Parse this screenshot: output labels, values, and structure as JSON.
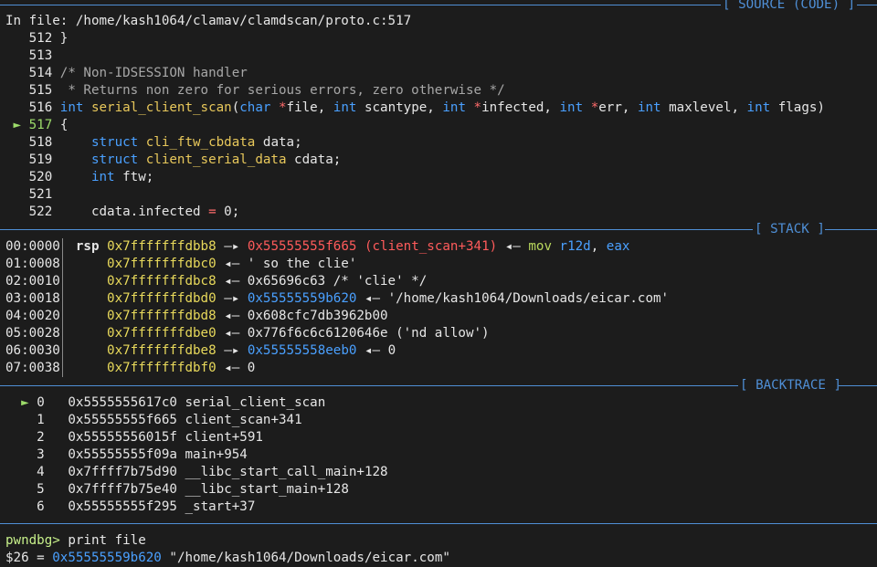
{
  "source": {
    "header_label": "[ SOURCE (CODE) ]",
    "file_line": "In file: /home/kash1064/clamav/clamdscan/proto.c:517",
    "lines": [
      {
        "num": "512",
        "text": "}"
      },
      {
        "num": "513",
        "text": ""
      },
      {
        "num": "514",
        "text": "/* Non-IDSESSION handler"
      },
      {
        "num": "515",
        "text": " * Returns non zero for serious errors, zero otherwise */"
      },
      {
        "num": "516",
        "text": "int serial_client_scan(char *file, int scantype, int *infected, int *err, int maxlevel, int flags)"
      },
      {
        "num": "517",
        "text": "{"
      },
      {
        "num": "518",
        "text": "    struct cli_ftw_cbdata data;"
      },
      {
        "num": "519",
        "text": "    struct client_serial_data cdata;"
      },
      {
        "num": "520",
        "text": "    int ftw;"
      },
      {
        "num": "521",
        "text": ""
      },
      {
        "num": "522",
        "text": "    cdata.infected = 0;"
      }
    ],
    "current_marker": "►"
  },
  "stack": {
    "header_label": "[ STACK ]",
    "rows": [
      {
        "offset": "00:0000",
        "reg": "rsp",
        "addr": "0x7fffffffdbb8",
        "arrow": "—▸",
        "target": "0x55555555f665 (client_scan+341)",
        "tail": "◂— mov r12d, eax"
      },
      {
        "offset": "01:0008",
        "addr": "0x7fffffffdbc0",
        "tail": "◂— ' so the clie'"
      },
      {
        "offset": "02:0010",
        "addr": "0x7fffffffdbc8",
        "tail": "◂— 0x65696c63 /* 'clie' */"
      },
      {
        "offset": "03:0018",
        "addr": "0x7fffffffdbd0",
        "arrow": "—▸",
        "target": "0x55555559b620",
        "tail": "◂— '/home/kash1064/Downloads/eicar.com'"
      },
      {
        "offset": "04:0020",
        "addr": "0x7fffffffdbd8",
        "tail": "◂— 0x608cfc7db3962b00"
      },
      {
        "offset": "05:0028",
        "addr": "0x7fffffffdbe0",
        "tail": "◂— 0x776f6c6c6120646e ('nd allow')"
      },
      {
        "offset": "06:0030",
        "addr": "0x7fffffffdbe8",
        "arrow": "—▸",
        "target": "0x55555558eeb0",
        "tail": "◂— 0"
      },
      {
        "offset": "07:0038",
        "addr": "0x7fffffffdbf0",
        "tail": "◂— 0"
      }
    ]
  },
  "backtrace": {
    "header_label": "[ BACKTRACE ]",
    "frames": [
      {
        "marker": "►",
        "idx": "0",
        "addr": "0x5555555617c0",
        "sym": "serial_client_scan"
      },
      {
        "marker": "",
        "idx": "1",
        "addr": "0x55555555f665",
        "sym": "client_scan+341"
      },
      {
        "marker": "",
        "idx": "2",
        "addr": "0x55555556015f",
        "sym": "client+591"
      },
      {
        "marker": "",
        "idx": "3",
        "addr": "0x55555555f09a",
        "sym": "main+954"
      },
      {
        "marker": "",
        "idx": "4",
        "addr": "0x7ffff7b75d90",
        "sym": "__libc_start_call_main+128"
      },
      {
        "marker": "",
        "idx": "5",
        "addr": "0x7ffff7b75e40",
        "sym": "__libc_start_main+128"
      },
      {
        "marker": "",
        "idx": "6",
        "addr": "0x55555555f295",
        "sym": "_start+37"
      }
    ]
  },
  "console": {
    "prompt": "pwndbg>",
    "command": "print file",
    "result_var": "$26 =",
    "result_addr": "0x55555559b620",
    "result_str": "\"/home/kash1064/Downloads/eicar.com\""
  }
}
